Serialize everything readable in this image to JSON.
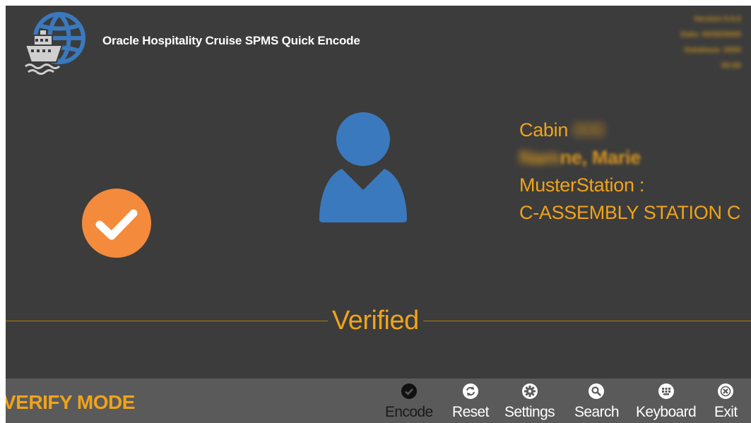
{
  "header": {
    "app_title": "Oracle Hospitality Cruise SPMS Quick Encode",
    "version_info": [
      "Version 0.0.0",
      "Date: 00/00/0000",
      "Database: 0000",
      "00:00"
    ]
  },
  "guest": {
    "cabin_label": "Cabin",
    "cabin_number": "000",
    "name_hidden": "Nam",
    "name_visible": "ne, Marie",
    "muster_label": "MusterStation :",
    "muster_station": "C-ASSEMBLY STATION C"
  },
  "status": {
    "verified_text": "Verified"
  },
  "footer": {
    "mode": "VERIFY MODE",
    "tools": [
      {
        "label": "Encode",
        "icon": "encode-icon",
        "active": true
      },
      {
        "label": "Reset",
        "icon": "reset-icon"
      },
      {
        "label": "Settings",
        "icon": "settings-icon"
      },
      {
        "label": "Search",
        "icon": "search-icon"
      },
      {
        "label": "Keyboard",
        "icon": "keyboard-icon"
      },
      {
        "label": "Exit",
        "icon": "exit-icon"
      }
    ]
  },
  "colors": {
    "background": "#3c3c3c",
    "accent": "#f0a31a",
    "badge": "#f48a3c",
    "avatar": "#3a79bd",
    "footer": "#5a5a5a"
  }
}
